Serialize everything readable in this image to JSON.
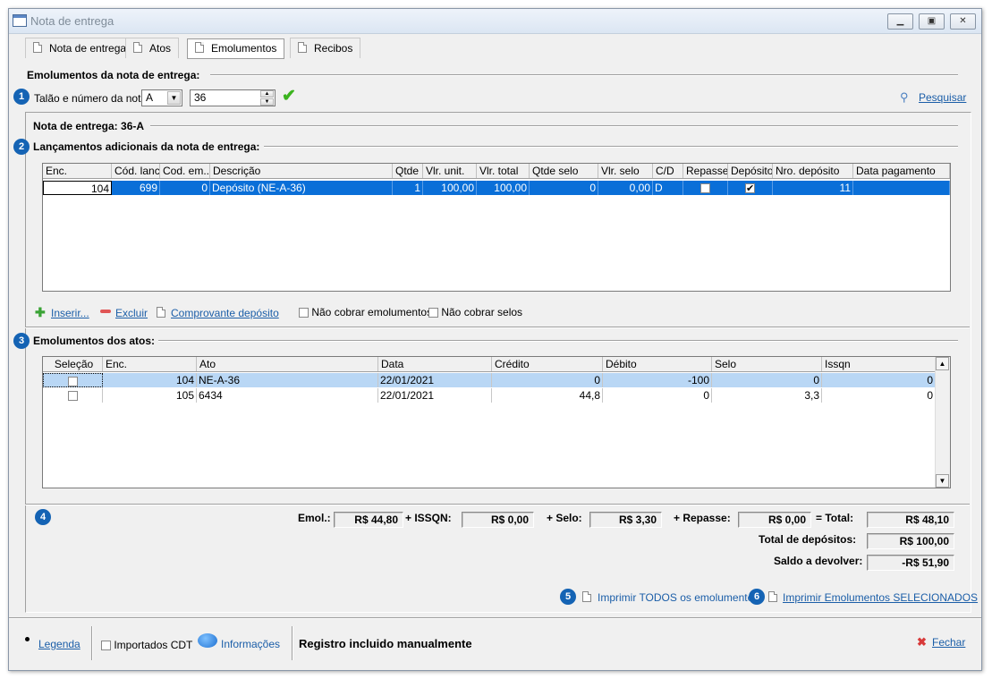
{
  "window": {
    "title": "Nota de entrega"
  },
  "tabs": [
    {
      "label": "Nota de entrega"
    },
    {
      "label": "Atos"
    },
    {
      "label": "Emolumentos"
    },
    {
      "label": "Recibos"
    }
  ],
  "section_main": {
    "title": "Emolumentos da nota de entrega:"
  },
  "talao": {
    "label": "Talão e número da nota:",
    "series_value": "A",
    "number_value": "36",
    "search_label": "Pesquisar"
  },
  "nota": {
    "title": "Nota de entrega: 36-A"
  },
  "lancamentos": {
    "title": "Lançamentos adicionais da nota de entrega:",
    "columns": [
      "Enc.",
      "Cód. lanc.",
      "Cod. em...",
      "Descrição",
      "Qtde",
      "Vlr. unit.",
      "Vlr. total",
      "Qtde selo",
      "Vlr. selo",
      "C/D",
      "Repasse",
      "Depósito",
      "Nro. depósito",
      "Data pagamento"
    ],
    "rows": [
      {
        "enc": "104",
        "cod_lanc": "699",
        "cod_em": "0",
        "descricao": "Depósito (NE-A-36)",
        "qtde": "1",
        "vlr_unit": "100,00",
        "vlr_total": "100,00",
        "qtde_selo": "0",
        "vlr_selo": "0,00",
        "cd": "D",
        "repasse": false,
        "deposito": true,
        "nro_deposito": "11",
        "data_pagamento": ""
      }
    ],
    "actions": {
      "insert": "Inserir...",
      "delete": "Excluir",
      "receipt": "Comprovante depósito"
    },
    "options": {
      "no_emol": "Não cobrar emolumentos",
      "no_selos": "Não cobrar selos"
    }
  },
  "atos": {
    "title": "Emolumentos dos atos:",
    "columns": [
      "Seleção",
      "Enc.",
      "Ato",
      "Data",
      "Crédito",
      "Débito",
      "Selo",
      "Issqn"
    ],
    "rows": [
      {
        "selecao": false,
        "enc": "104",
        "ato": "NE-A-36",
        "data": "22/01/2021",
        "credito": "0",
        "debito": "-100",
        "selo": "0",
        "issqn": "0"
      },
      {
        "selecao": false,
        "enc": "105",
        "ato": "6434",
        "data": "22/01/2021",
        "credito": "44,8",
        "debito": "0",
        "selo": "3,3",
        "issqn": "0"
      }
    ]
  },
  "totals": {
    "emol_label": "Emol.:",
    "emol_value": "R$ 44,80",
    "issqn_label": "+ ISSQN:",
    "issqn_value": "R$ 0,00",
    "selo_label": "+ Selo:",
    "selo_value": "R$ 3,30",
    "repasse_label": "+ Repasse:",
    "repasse_value": "R$ 0,00",
    "total_label": "= Total:",
    "total_value": "R$ 48,10",
    "depositos_label": "Total de depósitos:",
    "depositos_value": "R$ 100,00",
    "saldo_label": "Saldo a devolver:",
    "saldo_value": "-R$ 51,90"
  },
  "print": {
    "all": "Imprimir TODOS os emolumentos",
    "selected": "Imprimir Emolumentos SELECIONADOS"
  },
  "markers": [
    "1",
    "2",
    "3",
    "4",
    "5",
    "6"
  ],
  "footer": {
    "legend": "Legenda",
    "importados": "Importados CDT",
    "info": "Informações",
    "status": "Registro incluido manualmente",
    "close": "Fechar"
  },
  "colors": {
    "accent": "#1463b4",
    "selection": "#0a6fd8",
    "link": "#1b5ea8"
  }
}
